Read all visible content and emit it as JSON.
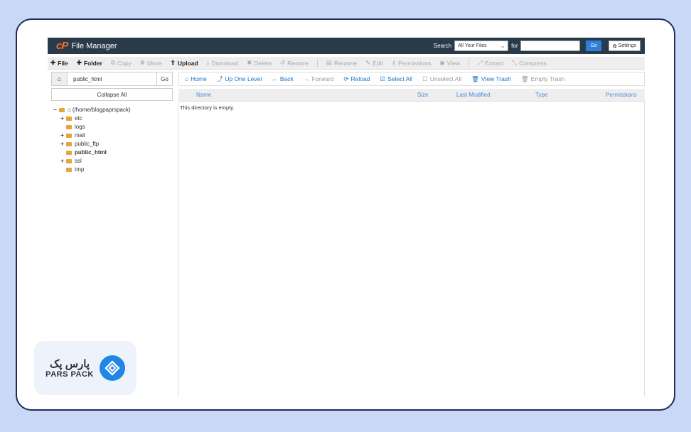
{
  "header": {
    "app_title": "File Manager",
    "search_label": "Search",
    "search_scope": "All Your Files",
    "for_label": "for",
    "go_label": "Go",
    "settings_label": "Settings"
  },
  "toolbar": {
    "items": [
      {
        "label": "File",
        "icon": "plus",
        "enabled": true
      },
      {
        "label": "Folder",
        "icon": "plus",
        "enabled": true
      },
      {
        "label": "Copy",
        "icon": "copy",
        "enabled": false
      },
      {
        "label": "Move",
        "icon": "move",
        "enabled": false
      },
      {
        "label": "Upload",
        "icon": "upload",
        "enabled": true
      },
      {
        "label": "Download",
        "icon": "download",
        "enabled": false
      },
      {
        "label": "Delete",
        "icon": "x",
        "enabled": false
      },
      {
        "label": "Restore",
        "icon": "undo",
        "enabled": false
      },
      {
        "label": "Rename",
        "icon": "file",
        "enabled": false
      },
      {
        "label": "Edit",
        "icon": "pencil",
        "enabled": false
      },
      {
        "label": "Permissions",
        "icon": "key",
        "enabled": false
      },
      {
        "label": "View",
        "icon": "eye",
        "enabled": false
      },
      {
        "label": "Extract",
        "icon": "expand",
        "enabled": false
      },
      {
        "label": "Compress",
        "icon": "compress",
        "enabled": false
      }
    ]
  },
  "path": {
    "value": "public_html",
    "go_label": "Go"
  },
  "sidebar": {
    "collapse_label": "Collapse All",
    "root_label": "(/home/blogpaprspack)",
    "tree": [
      {
        "label": "etc",
        "expandable": true,
        "bold": false
      },
      {
        "label": "logs",
        "expandable": false,
        "bold": false
      },
      {
        "label": "mail",
        "expandable": true,
        "bold": false
      },
      {
        "label": "public_ftp",
        "expandable": true,
        "bold": false
      },
      {
        "label": "public_html",
        "expandable": false,
        "bold": true
      },
      {
        "label": "ssl",
        "expandable": true,
        "bold": false
      },
      {
        "label": "tmp",
        "expandable": false,
        "bold": false
      }
    ]
  },
  "nav": {
    "items": [
      {
        "label": "Home",
        "enabled": true
      },
      {
        "label": "Up One Level",
        "enabled": true
      },
      {
        "label": "Back",
        "enabled": true
      },
      {
        "label": "Forward",
        "enabled": false
      },
      {
        "label": "Reload",
        "enabled": true
      },
      {
        "label": "Select All",
        "enabled": true
      },
      {
        "label": "Unselect All",
        "enabled": false
      },
      {
        "label": "View Trash",
        "enabled": true
      },
      {
        "label": "Empty Trash",
        "enabled": false
      }
    ]
  },
  "table": {
    "columns": [
      "Name",
      "Size",
      "Last Modified",
      "Type",
      "Permissions"
    ],
    "empty_message": "This directory is empty."
  },
  "badge": {
    "text_fa": "پارس پک",
    "text_en": "PARS PACK"
  },
  "colors": {
    "header_bg": "#293a4a",
    "accent": "#2f7ed8",
    "link": "#1a73c8",
    "folder": "#e8a33a",
    "logo_orange": "#ff6c2c",
    "frame_border": "#1f2a5c",
    "badge_blue": "#1e86e4"
  }
}
